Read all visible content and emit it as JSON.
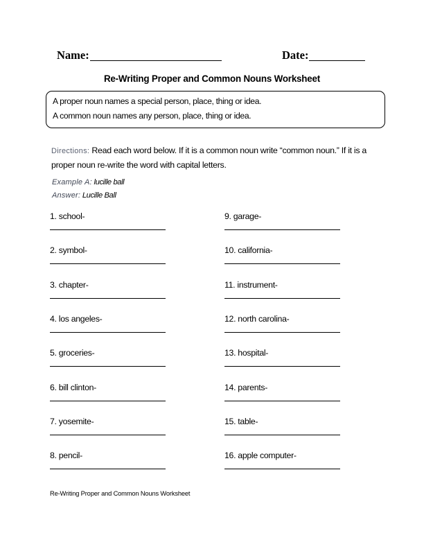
{
  "header": {
    "name_label": "Name:",
    "date_label": "Date:"
  },
  "title": "Re-Writing Proper and Common Nouns Worksheet",
  "definitions": [
    "A proper noun names a special person, place, thing or idea.",
    "A common noun names any person, place, thing or idea."
  ],
  "directions": {
    "label": "Directions:",
    "text": " Read each word below. If it is a common noun write “common noun.” If it is a proper noun re-write the word with capital letters."
  },
  "example": {
    "example_label": "Example A:",
    "example_value": " lucille ball",
    "answer_label": "Answer:",
    "answer_value": " Lucille Ball"
  },
  "items_left": [
    {
      "prompt": "1. school-"
    },
    {
      "prompt": "2. symbol-"
    },
    {
      "prompt": "3. chapter-"
    },
    {
      "prompt": "4. los angeles-"
    },
    {
      "prompt": "5. groceries-"
    },
    {
      "prompt": "6. bill clinton-"
    },
    {
      "prompt": "7. yosemite-"
    },
    {
      "prompt": "8. pencil-"
    }
  ],
  "items_right": [
    {
      "prompt": "9. garage-"
    },
    {
      "prompt": "10. california-"
    },
    {
      "prompt": "11. instrument-"
    },
    {
      "prompt": "12. north carolina-"
    },
    {
      "prompt": "13. hospital-"
    },
    {
      "prompt": "14. parents-"
    },
    {
      "prompt": "15. table-"
    },
    {
      "prompt": "16. apple computer-"
    }
  ],
  "footer": "Re-Writing Proper and Common Nouns Worksheet"
}
